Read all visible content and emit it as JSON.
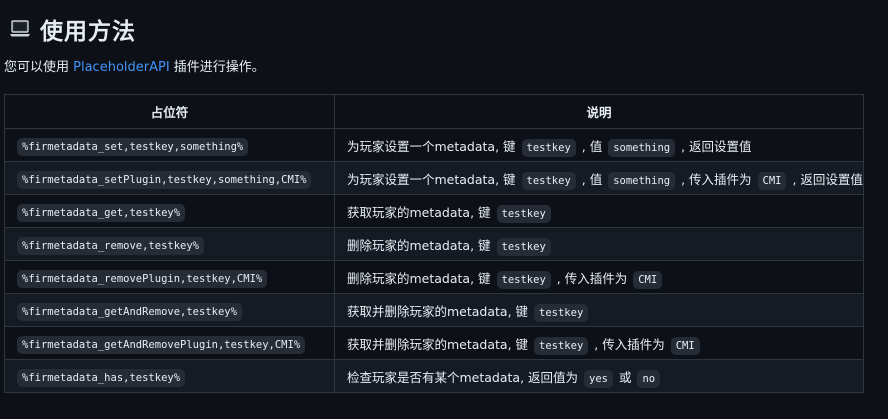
{
  "heading": {
    "icon": "laptop-icon",
    "title": "使用方法"
  },
  "intro": {
    "before": "您可以使用 ",
    "link": "PlaceholderAPI",
    "after": " 插件进行操作。"
  },
  "table": {
    "headers": [
      "占位符",
      "说明"
    ],
    "rows": [
      {
        "placeholder": "%firmetadata_set,testkey,something%",
        "desc": [
          {
            "t": "为玩家设置一个metadata, 键 "
          },
          {
            "c": "testkey"
          },
          {
            "t": " , 值 "
          },
          {
            "c": "something"
          },
          {
            "t": " , 返回设置值"
          }
        ]
      },
      {
        "placeholder": "%firmetadata_setPlugin,testkey,something,CMI%",
        "desc": [
          {
            "t": "为玩家设置一个metadata, 键 "
          },
          {
            "c": "testkey"
          },
          {
            "t": " , 值 "
          },
          {
            "c": "something"
          },
          {
            "t": " , 传入插件为 "
          },
          {
            "c": "CMI"
          },
          {
            "t": " , 返回设置值"
          }
        ]
      },
      {
        "placeholder": "%firmetadata_get,testkey%",
        "desc": [
          {
            "t": "获取玩家的metadata, 键 "
          },
          {
            "c": "testkey"
          }
        ]
      },
      {
        "placeholder": "%firmetadata_remove,testkey%",
        "desc": [
          {
            "t": "删除玩家的metadata, 键 "
          },
          {
            "c": "testkey"
          }
        ]
      },
      {
        "placeholder": "%firmetadata_removePlugin,testkey,CMI%",
        "desc": [
          {
            "t": "删除玩家的metadata, 键 "
          },
          {
            "c": "testkey"
          },
          {
            "t": " , 传入插件为 "
          },
          {
            "c": "CMI"
          }
        ]
      },
      {
        "placeholder": "%firmetadata_getAndRemove,testkey%",
        "desc": [
          {
            "t": "获取并删除玩家的metadata, 键 "
          },
          {
            "c": "testkey"
          }
        ]
      },
      {
        "placeholder": "%firmetadata_getAndRemovePlugin,testkey,CMI%",
        "desc": [
          {
            "t": "获取并删除玩家的metadata, 键 "
          },
          {
            "c": "testkey"
          },
          {
            "t": " , 传入插件为 "
          },
          {
            "c": "CMI"
          }
        ]
      },
      {
        "placeholder": "%firmetadata_has,testkey%",
        "desc": [
          {
            "t": "检查玩家是否有某个metadata, 返回值为 "
          },
          {
            "c": "yes"
          },
          {
            "t": " 或 "
          },
          {
            "c": "no"
          }
        ]
      }
    ]
  },
  "colors": {
    "background": "#0d1117",
    "stripe": "#151b23",
    "border": "#30363d",
    "link": "#4493f8",
    "code_bg": "#262c36"
  }
}
